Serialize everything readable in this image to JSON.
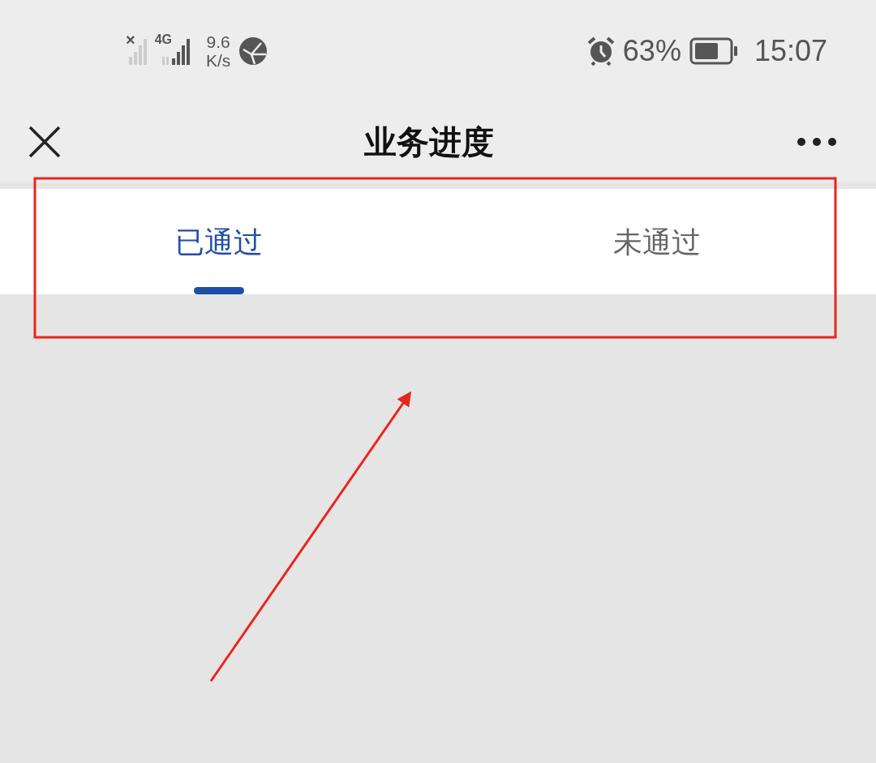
{
  "status_bar": {
    "sim_mark": "×",
    "network": "4G",
    "speed": "9.6",
    "speed_unit": "K/s",
    "battery": "63%",
    "time": "15:07"
  },
  "window": {
    "title": "业务进度"
  },
  "tabs": [
    {
      "label": "已通过",
      "selected": true
    },
    {
      "label": "未通过",
      "selected": false
    }
  ]
}
